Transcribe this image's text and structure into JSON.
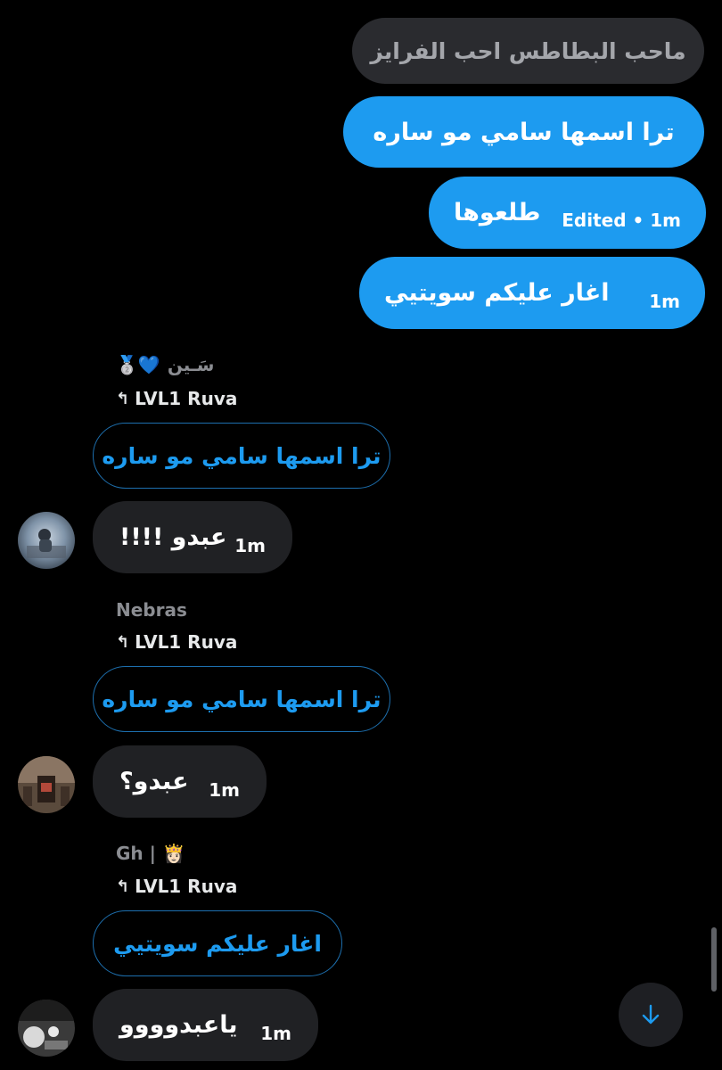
{
  "outgoing": [
    {
      "text": "ماحب البطاطس احب الفرايز",
      "time": ""
    },
    {
      "text": "ترا اسمها سامي مو ساره",
      "time": ""
    },
    {
      "text": "طلعوها",
      "time": "Edited • 1m"
    },
    {
      "text": "اغار عليكم سويتيي",
      "time": "1m"
    }
  ],
  "incoming": [
    {
      "sender": "سَـين",
      "sender_badges": "🥈💙",
      "reply_to": "LVL1 Ruva",
      "quote": "ترا اسمها سامي مو ساره",
      "text": "عبدو !!!!",
      "time": "1m"
    },
    {
      "sender": "Nebras",
      "sender_badges": "",
      "reply_to": "LVL1 Ruva",
      "quote": "ترا اسمها سامي مو ساره",
      "text": "عبدو؟",
      "time": "1m"
    },
    {
      "sender": "Gh |",
      "sender_badges": "👸🏻",
      "reply_to": "LVL1 Ruva",
      "quote": "اغار عليكم سويتيي",
      "text": "ياعبدوووو",
      "time": "1m"
    }
  ],
  "icons": {
    "reply": "reply-arrow-icon",
    "scroll_down": "arrow-down-icon"
  },
  "colors": {
    "background": "#000000",
    "accent": "#1d9bf0",
    "bubble_incoming": "#202124",
    "bubble_quoted": "#2a2b2f",
    "muted_text": "#8b8d92"
  }
}
